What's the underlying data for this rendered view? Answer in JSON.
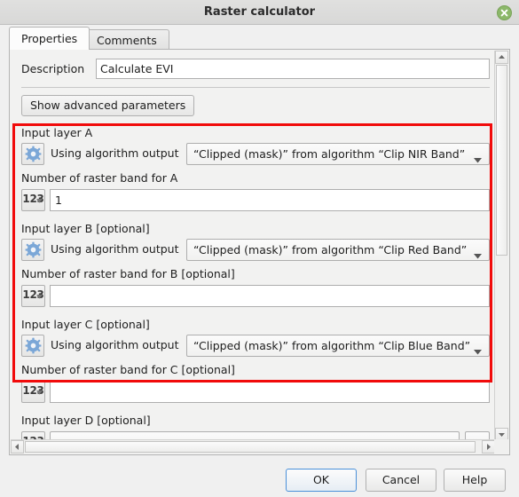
{
  "window": {
    "title": "Raster calculator",
    "close_icon": "close-icon"
  },
  "tabs": [
    {
      "label": "Properties",
      "active": true
    },
    {
      "label": "Comments",
      "active": false
    }
  ],
  "form": {
    "description": {
      "label": "Description",
      "value": "Calculate EVI",
      "placeholder": ""
    },
    "advanced_button": "Show advanced parameters",
    "sections": [
      {
        "layer_label": "Input layer A",
        "gear_icon": "gear-icon",
        "using_text": "Using algorithm output",
        "combo_value": "“Clipped (mask)” from algorithm “Clip NIR Band”",
        "band_label": "Number of raster band for A",
        "band_icon": "number-123-icon",
        "band_value": "1"
      },
      {
        "layer_label": "Input layer B [optional]",
        "gear_icon": "gear-icon",
        "using_text": "Using algorithm output",
        "combo_value": "“Clipped (mask)” from algorithm “Clip Red Band”",
        "band_label": "Number of raster band for B [optional]",
        "band_icon": "number-123-icon",
        "band_value": ""
      },
      {
        "layer_label": "Input layer C [optional]",
        "gear_icon": "gear-icon",
        "using_text": "Using algorithm output",
        "combo_value": "“Clipped (mask)” from algorithm “Clip Blue Band”",
        "band_label": "Number of raster band for C [optional]",
        "band_icon": "number-123-icon",
        "band_value": ""
      }
    ],
    "layer_d": {
      "layer_label": "Input layer D [optional]",
      "band_icon": "number-123-icon",
      "value": "",
      "ellipsis_label": "…"
    }
  },
  "annotation": {
    "color": "#f10b0b",
    "shape": "rectangle"
  },
  "buttons": {
    "ok": "OK",
    "cancel": "Cancel",
    "help": "Help"
  },
  "scrollbars": {
    "vertical_up_icon": "caret-up-icon",
    "vertical_down_icon": "caret-down-icon",
    "horizontal_left_icon": "caret-left-icon",
    "horizontal_right_icon": "caret-right-icon"
  }
}
